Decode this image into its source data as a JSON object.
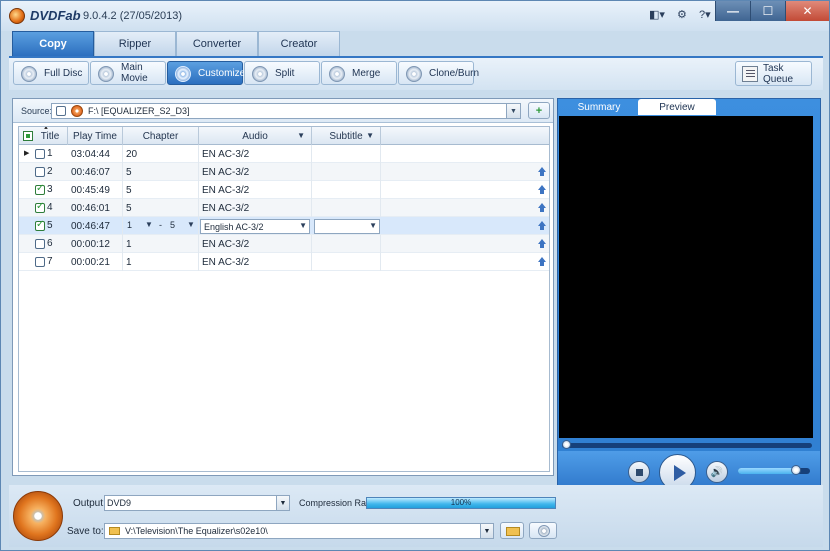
{
  "app": {
    "name": "DVDFab",
    "version": "9.0.4.2 (27/05/2013)"
  },
  "titlebar": {
    "icons": [
      "layout-icon",
      "gear-icon",
      "help-icon"
    ],
    "icon_glyphs": {
      "layout": "◧▾",
      "settings": "⚙",
      "help": "?▾"
    },
    "window_buttons": {
      "minimize": "—",
      "maximize": "☐",
      "close": "✕"
    }
  },
  "main_tabs": [
    "Copy",
    "Ripper",
    "Converter",
    "Creator"
  ],
  "mode_buttons": [
    "Full Disc",
    "Main Movie",
    "Customize",
    "Split",
    "Merge",
    "Clone/Burn"
  ],
  "task_queue_label": "Task Queue",
  "source": {
    "label": "Source:",
    "value": "F:\\ [EQUALIZER_S2_D3]",
    "add_glyph": "+"
  },
  "columns": {
    "title": "Title",
    "play_time": "Play Time",
    "chapter": "Chapter",
    "audio": "Audio",
    "subtitle": "Subtitle"
  },
  "rows": [
    {
      "title": "1",
      "time": "03:04:44",
      "chapter": "20",
      "audio": "EN AC-3/2",
      "checked": false,
      "pin": false,
      "expander": "▶"
    },
    {
      "title": "2",
      "time": "00:46:07",
      "chapter": "5",
      "audio": "EN AC-3/2",
      "checked": false,
      "pin": true,
      "expander": ""
    },
    {
      "title": "3",
      "time": "00:45:49",
      "chapter": "5",
      "audio": "EN AC-3/2",
      "checked": true,
      "pin": true,
      "expander": ""
    },
    {
      "title": "4",
      "time": "00:46:01",
      "chapter": "5",
      "audio": "EN AC-3/2",
      "checked": true,
      "pin": true,
      "expander": ""
    },
    {
      "title": "5",
      "time": "00:46:47",
      "chapter_from": "1",
      "chapter_sep": "-",
      "chapter_to": "5",
      "audio": "English AC-3/2",
      "subtitle": "",
      "checked": true,
      "pin": true,
      "expander": "",
      "editing": true
    },
    {
      "title": "6",
      "time": "00:00:12",
      "chapter": "1",
      "audio": "EN AC-3/2",
      "checked": false,
      "pin": true,
      "expander": ""
    },
    {
      "title": "7",
      "time": "00:00:21",
      "chapter": "1",
      "audio": "EN AC-3/2",
      "checked": false,
      "pin": true,
      "expander": ""
    }
  ],
  "right_panel": {
    "tabs": [
      "Summary",
      "Preview"
    ],
    "active_tab": "Preview",
    "seek_fraction": 0.0,
    "volume_fraction": 0.8,
    "vol_glyph": "🔊"
  },
  "output": {
    "label": "Output:",
    "value": "DVD9",
    "compression_label": "Compression Ratio:",
    "compression_value": "100%",
    "compression_fraction": 1.0,
    "save_label": "Save to:",
    "save_value": "V:\\Television\\The Equalizer\\s02e10\\"
  },
  "glyphs": {
    "dropdown": "▼",
    "sort": "▼",
    "sort_up": "▲"
  }
}
